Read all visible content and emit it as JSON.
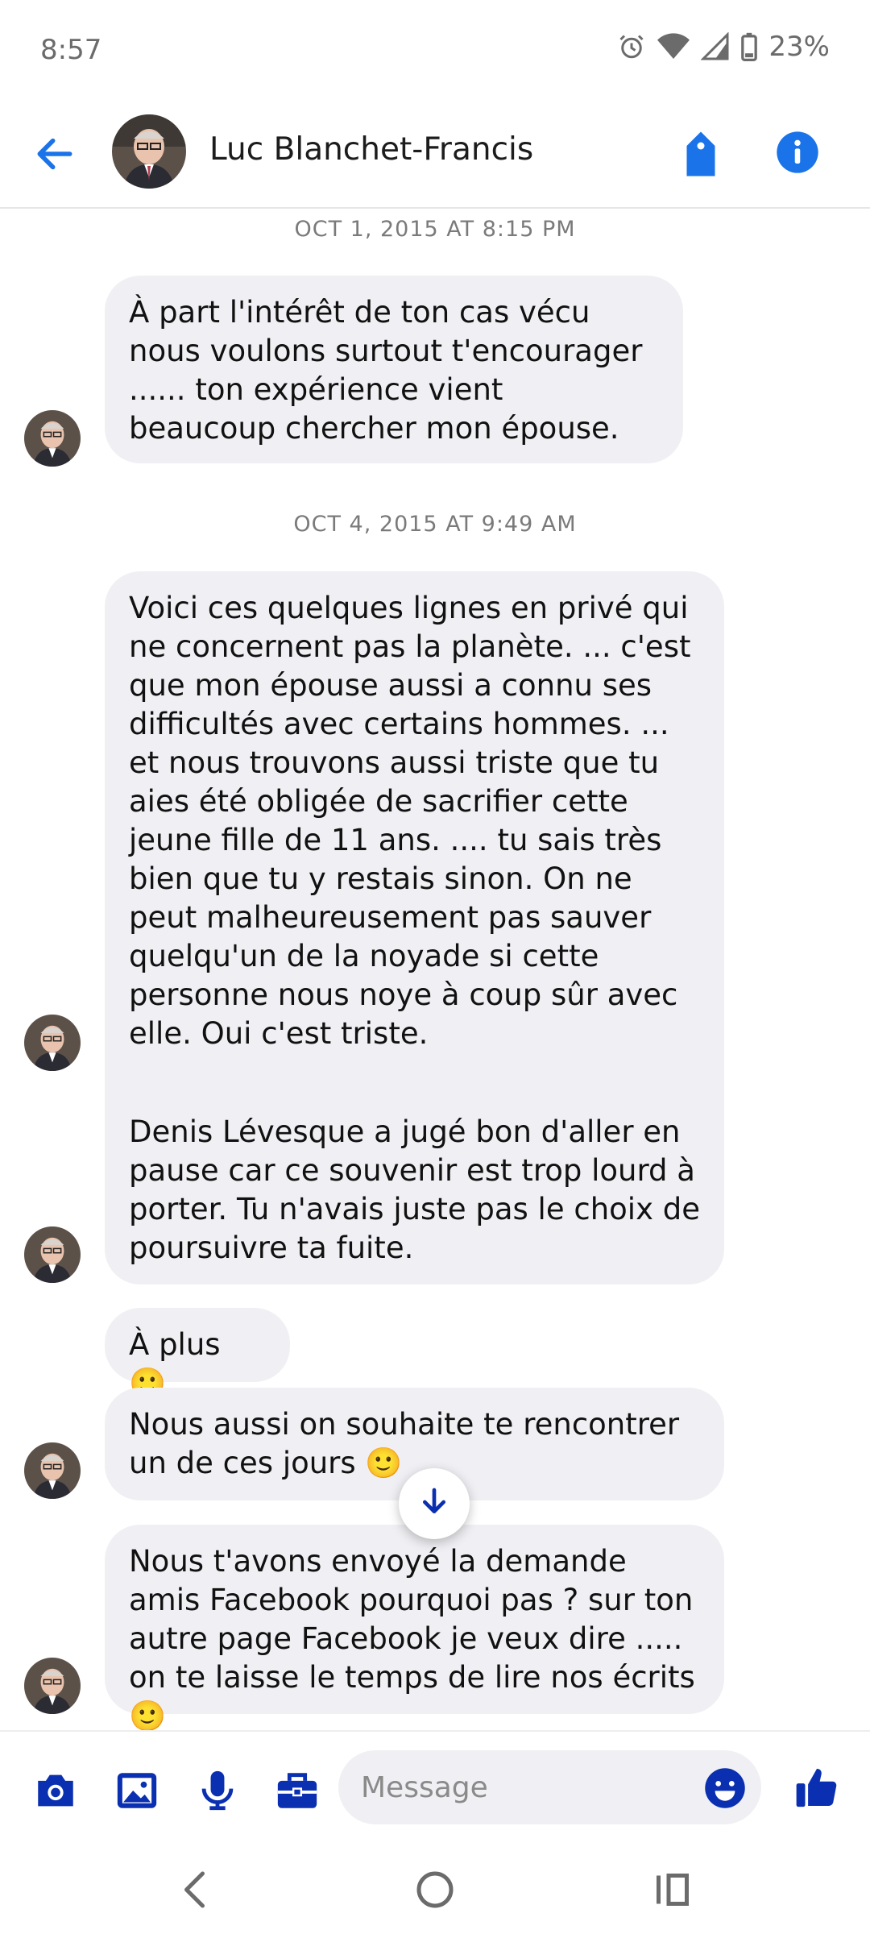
{
  "status_bar": {
    "time": "8:57",
    "battery": "23%"
  },
  "header": {
    "contact_name": "Luc Blanchet-Francis"
  },
  "messages": {
    "ts1": "OCT 1, 2015 AT 8:15 PM",
    "ts2": "OCT 4, 2015 AT 9:49 AM",
    "m1": "À part l'intérêt de ton cas vécu nous voulons surtout t'encourager ...... ton expérience vient beaucoup  chercher mon épouse.",
    "m2": "Voici ces quelques lignes en privé qui ne concernent pas la planète. ... c'est que mon épouse aussi a connu ses difficultés avec certains hommes. ... et nous trouvons aussi triste que tu aies été obligée de sacrifier cette jeune fille de 11 ans. .... tu sais très bien que tu y restais sinon. On ne peut malheureusement pas sauver quelqu'un de la noyade si cette personne nous noye à coup sûr avec elle. Oui c'est triste.",
    "m3": "Denis Lévesque a jugé bon d'aller en pause car ce souvenir est trop lourd à porter. Tu n'avais juste pas le choix de poursuivre ta fuite.",
    "m4": "À plus 🙂",
    "m5": "Nous aussi on souhaite te rencontrer un de ces jours 🙂",
    "m6": "Nous t'avons envoyé la demande amis Facebook pourquoi pas ? sur ton autre page Facebook je veux dire ..... on te laisse le temps de lire nos écrits 🙂"
  },
  "composer": {
    "placeholder": "Message"
  },
  "colors": {
    "accent": "#0a2fb0",
    "link_blue": "#1a73e8",
    "bubble": "#f0f0f4"
  },
  "icons": [
    "back-arrow-icon",
    "tag-icon",
    "info-icon",
    "camera-icon",
    "image-icon",
    "microphone-icon",
    "briefcase-icon",
    "emoji-icon",
    "thumbs-up-icon",
    "scroll-down-arrow-icon",
    "nav-back-icon",
    "nav-home-icon",
    "nav-recents-icon",
    "alarm-icon",
    "wifi-icon",
    "signal-icon",
    "battery-icon"
  ]
}
